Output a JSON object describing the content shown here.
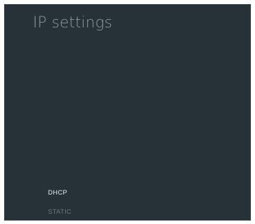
{
  "page": {
    "title": "IP settings"
  },
  "options": [
    {
      "label": "DHCP",
      "selected": true
    },
    {
      "label": "STATIC",
      "selected": false
    }
  ],
  "colors": {
    "background": "#263238",
    "title": "#8e9a9e",
    "selected_option": "#e7eaeb",
    "unselected_option": "#6b787c"
  }
}
